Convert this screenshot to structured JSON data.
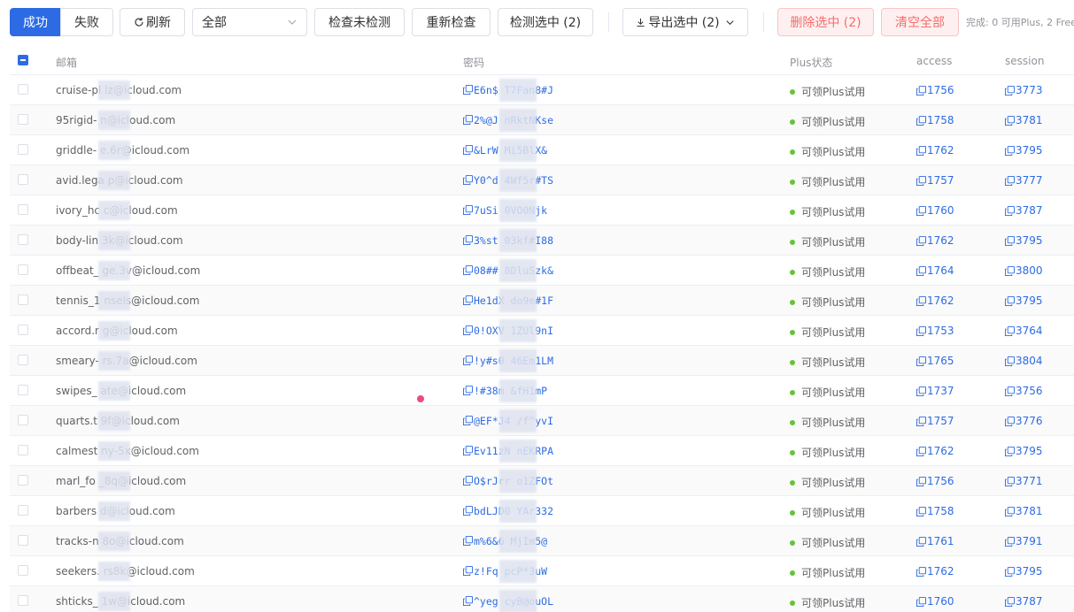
{
  "toolbar": {
    "seg_success": "成功",
    "seg_fail": "失败",
    "refresh": "刷新",
    "filter_value": "全部",
    "check_unchecked": "检查未检测",
    "recheck": "重新检查",
    "check_selected": "检测选中 (2)",
    "export_selected": "导出选中 (2)",
    "delete_selected": "删除选中 (2)",
    "clear_all": "清空全部",
    "status": "完成: 0 可用Plus, 2 Free"
  },
  "colors": {
    "primary": "#2d6be4",
    "danger": "#f56c6c",
    "success": "#67c23a"
  },
  "table": {
    "headers": {
      "email": "邮箱",
      "password": "密码",
      "plus": "Plus状态",
      "access": "access",
      "session": "session"
    },
    "rows": [
      {
        "email": "cruise-pl   lz@icloud.com",
        "password": "E6n$     T7Fan8#J",
        "plus": "可领Plus试用",
        "access": "1756",
        "session": "3773"
      },
      {
        "email": "95rigid-     n@icloud.com",
        "password": "2%@J     nRktNKse",
        "plus": "可领Plus试用",
        "access": "1758",
        "session": "3781"
      },
      {
        "email": "griddle-     e.6r@icloud.com",
        "password": "&LrW     Mi5BlX&",
        "plus": "可领Plus试用",
        "access": "1762",
        "session": "3795"
      },
      {
        "email": "avid.lega    p@icloud.com",
        "password": "Y0^d     4Wf5r#TS",
        "plus": "可领Plus试用",
        "access": "1757",
        "session": "3777"
      },
      {
        "email": "ivory_hc     c@icloud.com",
        "password": "7uSi     0VO0Njk",
        "plus": "可领Plus试用",
        "access": "1760",
        "session": "3787"
      },
      {
        "email": "body-lin     3k@icloud.com",
        "password": "3%st     03kf#I88",
        "plus": "可领Plus试用",
        "access": "1762",
        "session": "3795"
      },
      {
        "email": "offbeat_     ge.3v@icloud.com",
        "password": "08##     8DluSzk&",
        "plus": "可领Plus试用",
        "access": "1764",
        "session": "3800"
      },
      {
        "email": "tennis_1     nsels@icloud.com",
        "password": "He1dX     do9e#1F",
        "plus": "可领Plus试用",
        "access": "1762",
        "session": "3795"
      },
      {
        "email": "accord.r     g@icloud.com",
        "password": "0!OXV     1ZUl9nI",
        "plus": "可领Plus试用",
        "access": "1753",
        "session": "3764"
      },
      {
        "email": "smeary-      rs.7a@icloud.com",
        "password": "!y#s0     46Em1LM",
        "plus": "可领Plus试用",
        "access": "1765",
        "session": "3804"
      },
      {
        "email": "swipes_      ate@icloud.com",
        "password": "!#38m     &fH1mP",
        "plus": "可领Plus试用",
        "access": "1737",
        "session": "3756"
      },
      {
        "email": "quarts.t     9f@icloud.com",
        "password": "@EF*J4     /f^yvI",
        "plus": "可领Plus试用",
        "access": "1757",
        "session": "3776"
      },
      {
        "email": "calmest      ny-5x@icloud.com",
        "password": "Ev11zN     nEKRPA",
        "plus": "可领Plus试用",
        "access": "1762",
        "session": "3795"
      },
      {
        "email": "marl_fo      _8q@icloud.com",
        "password": "O$rJrr     o1ZFOt",
        "plus": "可领Plus试用",
        "access": "1756",
        "session": "3771"
      },
      {
        "email": "barbers      d@icloud.com",
        "password": "bdLJD0     YAr332",
        "plus": "可领Plus试用",
        "access": "1758",
        "session": "3781"
      },
      {
        "email": "tracks-n     8o@icloud.com",
        "password": "m%6&6     MjIm5@",
        "plus": "可领Plus试用",
        "access": "1761",
        "session": "3791"
      },
      {
        "email": "seekers.     rs8k@icloud.com",
        "password": "z!Fq     pcP*3uW",
        "plus": "可领Plus试用",
        "access": "1762",
        "session": "3795"
      },
      {
        "email": "shticks_     1w@icloud.com",
        "password": "^yeg     cyB@ouOL",
        "plus": "可领Plus试用",
        "access": "1760",
        "session": "3787"
      }
    ]
  }
}
